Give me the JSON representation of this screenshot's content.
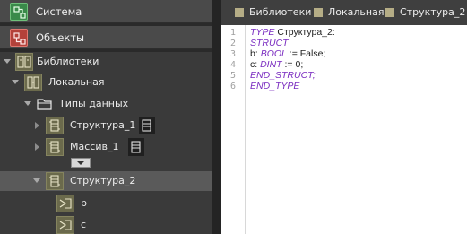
{
  "left_panel": {
    "sections": [
      {
        "label": "Система",
        "icon": "system-icon"
      },
      {
        "label": "Объекты",
        "icon": "objects-icon"
      }
    ],
    "tree": [
      {
        "label": "Библиотеки",
        "icon": "libraries-icon",
        "expanded": true
      },
      {
        "label": "Локальная",
        "icon": "local-library-icon",
        "expanded": true
      },
      {
        "label": "Типы данных",
        "icon": "folder-icon",
        "expanded": true
      },
      {
        "label": "Структура_1",
        "icon": "struct-icon",
        "expanded": false
      },
      {
        "label": "Массив_1",
        "icon": "struct-icon",
        "expanded": false
      },
      {
        "label": "Структура_2",
        "icon": "struct-icon",
        "expanded": true,
        "selected": true
      },
      {
        "label": "b",
        "icon": "variable-icon"
      },
      {
        "label": "c",
        "icon": "variable-icon"
      }
    ]
  },
  "tabs": [
    {
      "label": "Библиотеки"
    },
    {
      "label": "Локальная"
    },
    {
      "label": "Структура_2"
    }
  ],
  "editor": {
    "line_numbers": [
      "1",
      "2",
      "3",
      "4",
      "5",
      "6"
    ],
    "lines": [
      {
        "kw1": "TYPE",
        "text1": " Структура_2:"
      },
      {
        "kw1": "STRUCT"
      },
      {
        "text1": "b: ",
        "kw2": "BOOL",
        "text2": " := False;"
      },
      {
        "text1": "c: ",
        "kw2": "DINT",
        "text2": " := 0;"
      },
      {
        "kw1": "END_STRUCT;"
      },
      {
        "kw1": "END_TYPE"
      }
    ]
  },
  "colors": {
    "keyword": "#7a2cc0",
    "selection": "#5a5a5a",
    "tree_icon": "#6b6a4c"
  }
}
